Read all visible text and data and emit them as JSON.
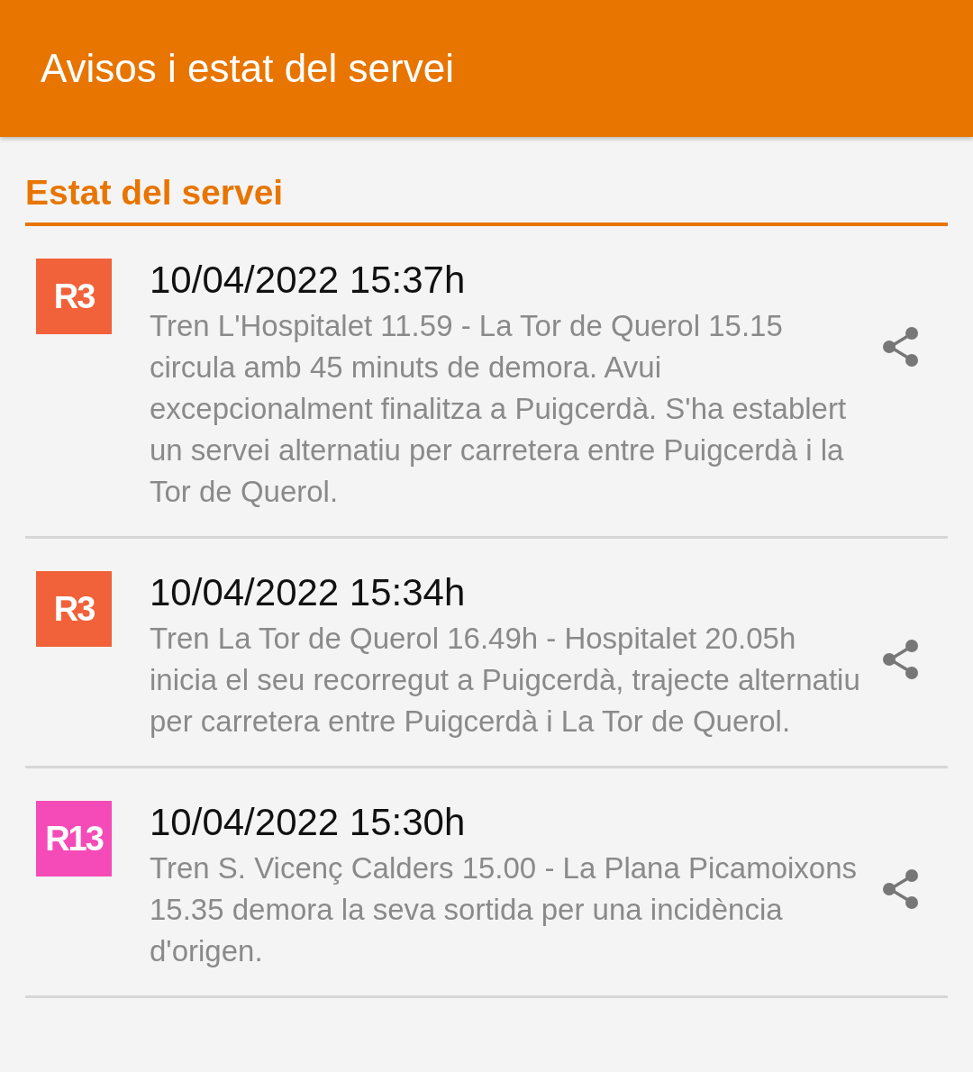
{
  "app_bar": {
    "title": "Avisos i estat del servei"
  },
  "section": {
    "title": "Estat del servei"
  },
  "notices": [
    {
      "line": "R3",
      "color": "#f1623a",
      "datetime": "10/04/2022 15:37h",
      "text": "Tren L'Hospitalet 11.59 - La Tor de Querol 15.15 circula amb 45 minuts de demora. Avui excepcionalment finalitza a Puigcerdà. S'ha establert un servei alternatiu per carretera entre Puigcerdà i la Tor de Querol."
    },
    {
      "line": "R3",
      "color": "#f1623a",
      "datetime": "10/04/2022 15:34h",
      "text": "Tren La Tor de Querol 16.49h - Hospitalet 20.05h inicia el seu recorregut a Puigcerdà, trajecte alternatiu per carretera entre Puigcerdà i La Tor de Querol."
    },
    {
      "line": "R13",
      "color": "#f54bb8",
      "datetime": "10/04/2022 15:30h",
      "text": "Tren S. Vicenç Calders 15.00 - La Plana Picamoixons 15.35 demora la seva sortida per una incidència d'origen."
    }
  ]
}
